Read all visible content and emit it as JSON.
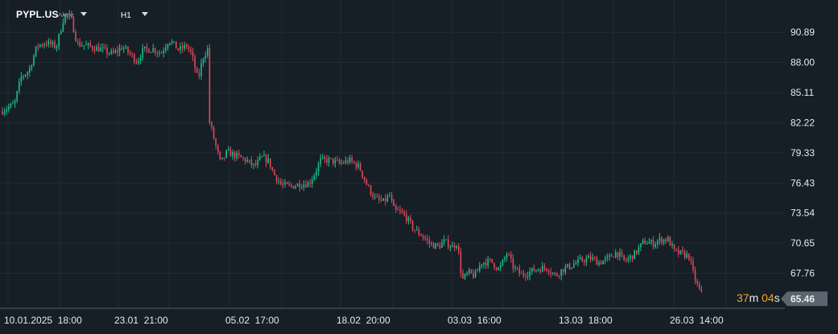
{
  "header": {
    "symbol": "PYPL.US",
    "symbol_type": "Akcie",
    "timeframe": "H1"
  },
  "countdown": {
    "minutes": "37",
    "minutes_unit": "m",
    "seconds": "04",
    "seconds_unit": "s"
  },
  "colors": {
    "background": "#161e26",
    "grid": "#222c35",
    "up": "#19c08a",
    "down": "#e0485a",
    "price_tag": "#5b6570",
    "countdown": "#f5a623"
  },
  "chart_data": {
    "type": "candlestick",
    "title": "",
    "xlabel": "",
    "ylabel": "",
    "ylim": [
      64.4,
      94.0
    ],
    "yticks": [
      90.89,
      88.0,
      85.11,
      82.22,
      79.33,
      76.43,
      73.54,
      70.65,
      67.76
    ],
    "ytick_labels": [
      "90.89",
      "88.00",
      "85.11",
      "82.22",
      "79.33",
      "76.43",
      "73.54",
      "70.65",
      "67.76"
    ],
    "xtick_labels": [
      "10.01.2025  18:00",
      "23.01  21:00",
      "05.02  17:00",
      "18.02  20:00",
      "03.03  16:00",
      "13.03  18:00",
      "26.03  14:00"
    ],
    "last_price": "65.46",
    "grid": true,
    "anchors": [
      [
        0,
        83.3
      ],
      [
        8,
        83.6
      ],
      [
        18,
        84.0
      ],
      [
        26,
        86.6
      ],
      [
        36,
        87.2
      ],
      [
        46,
        89.6
      ],
      [
        58,
        89.9
      ],
      [
        70,
        89.5
      ],
      [
        80,
        92.6
      ],
      [
        88,
        92.3
      ],
      [
        96,
        89.8
      ],
      [
        108,
        89.6
      ],
      [
        124,
        89.3
      ],
      [
        140,
        88.8
      ],
      [
        152,
        89.5
      ],
      [
        162,
        88.8
      ],
      [
        170,
        88.1
      ],
      [
        178,
        89.2
      ],
      [
        190,
        89.3
      ],
      [
        200,
        88.9
      ],
      [
        210,
        90.2
      ],
      [
        222,
        89.2
      ],
      [
        232,
        89.6
      ],
      [
        238,
        88.8
      ],
      [
        246,
        86.3
      ],
      [
        252,
        88.5
      ],
      [
        258,
        89.3
      ],
      [
        260,
        82.4
      ],
      [
        266,
        80.6
      ],
      [
        274,
        78.3
      ],
      [
        282,
        79.4
      ],
      [
        294,
        79.0
      ],
      [
        306,
        78.6
      ],
      [
        316,
        78.0
      ],
      [
        326,
        78.9
      ],
      [
        334,
        78.5
      ],
      [
        340,
        77.3
      ],
      [
        350,
        76.2
      ],
      [
        360,
        76.1
      ],
      [
        372,
        76.3
      ],
      [
        384,
        76.4
      ],
      [
        392,
        77.5
      ],
      [
        398,
        78.6
      ],
      [
        410,
        78.6
      ],
      [
        422,
        78.3
      ],
      [
        434,
        78.6
      ],
      [
        446,
        78.0
      ],
      [
        456,
        76.2
      ],
      [
        466,
        74.9
      ],
      [
        476,
        74.6
      ],
      [
        484,
        75.2
      ],
      [
        490,
        73.7
      ],
      [
        496,
        73.7
      ],
      [
        504,
        73.2
      ],
      [
        514,
        72.0
      ],
      [
        524,
        71.4
      ],
      [
        534,
        70.6
      ],
      [
        544,
        70.3
      ],
      [
        552,
        70.8
      ],
      [
        562,
        70.3
      ],
      [
        568,
        70.7
      ],
      [
        574,
        67.1
      ],
      [
        582,
        67.8
      ],
      [
        590,
        67.5
      ],
      [
        598,
        68.8
      ],
      [
        610,
        68.9
      ],
      [
        620,
        68.1
      ],
      [
        630,
        69.7
      ],
      [
        638,
        68.3
      ],
      [
        648,
        67.6
      ],
      [
        658,
        67.9
      ],
      [
        668,
        68.2
      ],
      [
        680,
        68.3
      ],
      [
        690,
        67.5
      ],
      [
        698,
        68.1
      ],
      [
        710,
        68.5
      ],
      [
        722,
        69.0
      ],
      [
        734,
        69.2
      ],
      [
        744,
        68.8
      ],
      [
        754,
        69.1
      ],
      [
        766,
        69.8
      ],
      [
        776,
        68.9
      ],
      [
        788,
        69.6
      ],
      [
        800,
        70.8
      ],
      [
        812,
        70.6
      ],
      [
        820,
        71.0
      ],
      [
        830,
        71.0
      ],
      [
        838,
        69.8
      ],
      [
        848,
        69.6
      ],
      [
        856,
        69.4
      ],
      [
        862,
        67.5
      ],
      [
        868,
        66.2
      ],
      [
        873,
        65.5
      ]
    ]
  }
}
